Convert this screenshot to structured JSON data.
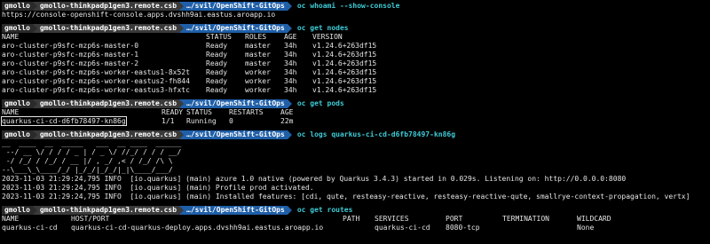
{
  "prompt": {
    "user": "gmollo",
    "host": "gmollo-thinkpadp1gen3.remote.csb",
    "path": "…/svil/OpenShift-GitOps"
  },
  "block1": {
    "command": "oc whoami --show-console",
    "output": "https://console-openshift-console.apps.dvshh9ai.eastus.aroapp.io"
  },
  "block2": {
    "command": "oc get nodes",
    "headers": [
      "NAME",
      "STATUS",
      "ROLES",
      "AGE",
      "VERSION"
    ],
    "rows": [
      [
        "aro-cluster-p9sfc-mzp6s-master-0",
        "Ready",
        "master",
        "34h",
        "v1.24.6+263df15"
      ],
      [
        "aro-cluster-p9sfc-mzp6s-master-1",
        "Ready",
        "master",
        "34h",
        "v1.24.6+263df15"
      ],
      [
        "aro-cluster-p9sfc-mzp6s-master-2",
        "Ready",
        "master",
        "34h",
        "v1.24.6+263df15"
      ],
      [
        "aro-cluster-p9sfc-mzp6s-worker-eastus1-8x52t",
        "Ready",
        "worker",
        "34h",
        "v1.24.6+263df15"
      ],
      [
        "aro-cluster-p9sfc-mzp6s-worker-eastus2-fh844",
        "Ready",
        "worker",
        "34h",
        "v1.24.6+263df15"
      ],
      [
        "aro-cluster-p9sfc-mzp6s-worker-eastus3-hfxtc",
        "Ready",
        "worker",
        "34h",
        "v1.24.6+263df15"
      ]
    ]
  },
  "block3": {
    "command": "oc get pods",
    "headers": [
      "NAME",
      "READY",
      "STATUS",
      "RESTARTS",
      "AGE"
    ],
    "rows": [
      [
        "quarkus-ci-cd-d6fb78497-kn86g",
        "1/1",
        "Running",
        "0",
        "22m"
      ]
    ]
  },
  "block4": {
    "command": "oc logs quarkus-ci-cd-d6fb78497-kn86g",
    "banner": [
      "__  ____  __  _____   ___  __ ____  ______ ",
      " --/ __ \\/ / / / _ | / _ \\/ //_/ / / / __/ ",
      " -/ /_/ / /_/ / __ |/ , _/ ,< / /_/ /\\ \\   ",
      "--\\___\\_\\____/_/ |_/_/|_/_/|_|\\____/___/   "
    ],
    "logs": [
      "2023-11-03 21:29:24,795 INFO  [io.quarkus] (main) azure 1.0 native (powered by Quarkus 3.4.3) started in 0.029s. Listening on: http://0.0.0.0:8080",
      "2023-11-03 21:29:24,795 INFO  [io.quarkus] (main) Profile prod activated.",
      "2023-11-03 21:29:24,795 INFO  [io.quarkus] (main) Installed features: [cdi, qute, resteasy-reactive, resteasy-reactive-qute, smallrye-context-propagation, vertx]"
    ]
  },
  "block5": {
    "command": "oc get routes",
    "headers": [
      "NAME",
      "HOST/PORT",
      "PATH",
      "SERVICES",
      "PORT",
      "TERMINATION",
      "WILDCARD"
    ],
    "rows": [
      [
        "quarkus-ci-cd",
        "quarkus-ci-cd-quarkus-deploy.apps.dvshh9ai.eastus.aroapp.io",
        "",
        "quarkus-ci-cd",
        "8080-tcp",
        "",
        "None"
      ]
    ]
  }
}
